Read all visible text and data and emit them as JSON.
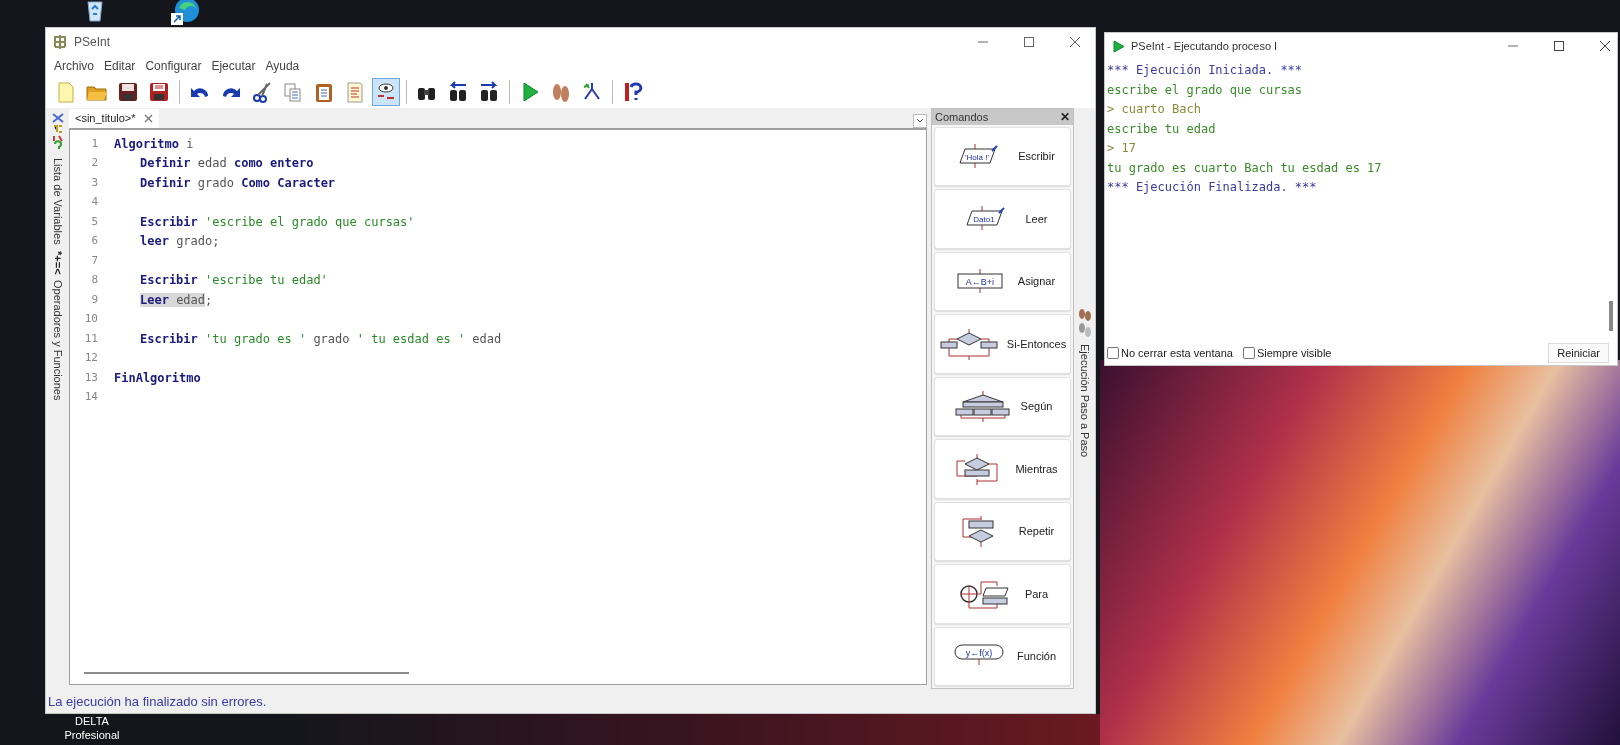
{
  "desktop": {
    "icon_label": [
      "DELTA",
      "Profesional"
    ]
  },
  "main_window": {
    "title": "PSeInt",
    "menu": [
      "Archivo",
      "Editar",
      "Configurar",
      "Ejecutar",
      "Ayuda"
    ],
    "toolbar": [
      {
        "kind": "new",
        "pressed": false
      },
      {
        "kind": "open",
        "pressed": false
      },
      {
        "kind": "save",
        "pressed": false
      },
      {
        "kind": "saveas",
        "pressed": false
      },
      {
        "kind": "separator"
      },
      {
        "kind": "undo",
        "pressed": false
      },
      {
        "kind": "redo",
        "pressed": false
      },
      {
        "kind": "cut",
        "pressed": false
      },
      {
        "kind": "copy",
        "pressed": false
      },
      {
        "kind": "paste",
        "pressed": false
      },
      {
        "kind": "doc",
        "pressed": false
      },
      {
        "kind": "eye",
        "pressed": true
      },
      {
        "kind": "separator"
      },
      {
        "kind": "find",
        "pressed": false
      },
      {
        "kind": "findprev",
        "pressed": false
      },
      {
        "kind": "findnext",
        "pressed": false
      },
      {
        "kind": "separator"
      },
      {
        "kind": "run",
        "pressed": false
      },
      {
        "kind": "step",
        "pressed": false
      },
      {
        "kind": "flow",
        "pressed": false
      },
      {
        "kind": "separator"
      },
      {
        "kind": "help",
        "pressed": false
      }
    ],
    "left_panels": [
      {
        "label": "Lista de Variables"
      },
      {
        "symbols": "*+=<",
        "label": "Operadores y Funciones"
      }
    ],
    "tabs": [
      {
        "label": "<sin_titulo>*",
        "selected": true
      }
    ],
    "code": [
      {
        "number": "1",
        "indented": false,
        "tokens": [
          {
            "text": "Algoritmo",
            "kind": "kw",
            "selected": false
          },
          {
            "text": " i",
            "kind": "id",
            "selected": false
          }
        ]
      },
      {
        "number": "2",
        "indented": true,
        "tokens": [
          {
            "text": "Definir",
            "kind": "kw",
            "selected": false
          },
          {
            "text": " edad ",
            "kind": "id",
            "selected": false
          },
          {
            "text": "como entero",
            "kind": "kw",
            "selected": false
          }
        ]
      },
      {
        "number": "3",
        "indented": true,
        "tokens": [
          {
            "text": "Definir",
            "kind": "kw",
            "selected": false
          },
          {
            "text": " grado ",
            "kind": "id",
            "selected": false
          },
          {
            "text": "Como Caracter",
            "kind": "kw",
            "selected": false
          }
        ]
      },
      {
        "number": "4"
      },
      {
        "number": "5",
        "indented": true,
        "tokens": [
          {
            "text": "Escribir",
            "kind": "kw",
            "selected": false
          },
          {
            "text": " 'escribe el grado que cursas'",
            "kind": "str",
            "selected": false
          }
        ]
      },
      {
        "number": "6",
        "indented": true,
        "tokens": [
          {
            "text": "leer",
            "kind": "kw",
            "selected": false
          },
          {
            "text": " grado;",
            "kind": "id",
            "selected": false
          }
        ]
      },
      {
        "number": "7"
      },
      {
        "number": "8",
        "indented": true,
        "tokens": [
          {
            "text": "Escribir",
            "kind": "kw",
            "selected": false
          },
          {
            "text": " 'escribe tu edad'",
            "kind": "str",
            "selected": false
          }
        ]
      },
      {
        "number": "9",
        "indented": true,
        "tokens": [
          {
            "text": "Leer",
            "kind": "kw",
            "selected": true
          },
          {
            "text": " edad",
            "kind": "id",
            "selected": true
          },
          {
            "text": ";",
            "kind": "id",
            "selected": false
          }
        ]
      },
      {
        "number": "10"
      },
      {
        "number": "11",
        "indented": true,
        "tokens": [
          {
            "text": "Escribir",
            "kind": "kw",
            "selected": false
          },
          {
            "text": " 'tu grado es '",
            "kind": "str",
            "selected": false
          },
          {
            "text": " grado ",
            "kind": "id",
            "selected": false
          },
          {
            "text": "' tu esdad es '",
            "kind": "str",
            "selected": false
          },
          {
            "text": " edad",
            "kind": "id",
            "selected": false
          }
        ]
      },
      {
        "number": "12"
      },
      {
        "number": "13",
        "indented": false,
        "tokens": [
          {
            "text": "FinAlgoritmo",
            "kind": "kw",
            "selected": false
          }
        ]
      },
      {
        "number": "14"
      }
    ],
    "commands": {
      "title": "Comandos",
      "close": "✕",
      "items": [
        {
          "kind": "write",
          "icon_text": "'Hola !'",
          "label": "Escribir"
        },
        {
          "kind": "read",
          "icon_text": "Dato1",
          "label": "Leer"
        },
        {
          "kind": "assign",
          "icon_text": "A←B+i",
          "label": "Asignar"
        },
        {
          "kind": "if",
          "label": "Si-Entonces"
        },
        {
          "kind": "switch",
          "label": "Según"
        },
        {
          "kind": "while",
          "label": "Mientras"
        },
        {
          "kind": "repeat",
          "label": "Repetir"
        },
        {
          "kind": "for",
          "label": "Para"
        },
        {
          "kind": "func",
          "icon_text": "y←f(x)",
          "label": "Función"
        }
      ]
    },
    "step_panel": {
      "label": "Ejecución Paso a Paso"
    },
    "status": "La ejecución ha finalizado sin errores."
  },
  "run_window": {
    "title": "PSeInt - Ejecutando proceso I",
    "lines": [
      {
        "kind": "info",
        "text": "*** Ejecución Iniciada. ***"
      },
      {
        "kind": "output",
        "text": "escribe el grado que cursas"
      },
      {
        "kind": "input",
        "text": "> cuarto Bach"
      },
      {
        "kind": "output",
        "text": "escribe tu edad"
      },
      {
        "kind": "input",
        "text": "> 17"
      },
      {
        "kind": "output",
        "text": "tu grado es cuarto Bach tu esdad es 17"
      },
      {
        "kind": "info",
        "text": "*** Ejecución Finalizada. ***"
      }
    ],
    "options": [
      {
        "label": "No cerrar esta ventana",
        "checked": false
      },
      {
        "label": "Siempre visible",
        "checked": false
      }
    ],
    "button": "Reiniciar"
  }
}
